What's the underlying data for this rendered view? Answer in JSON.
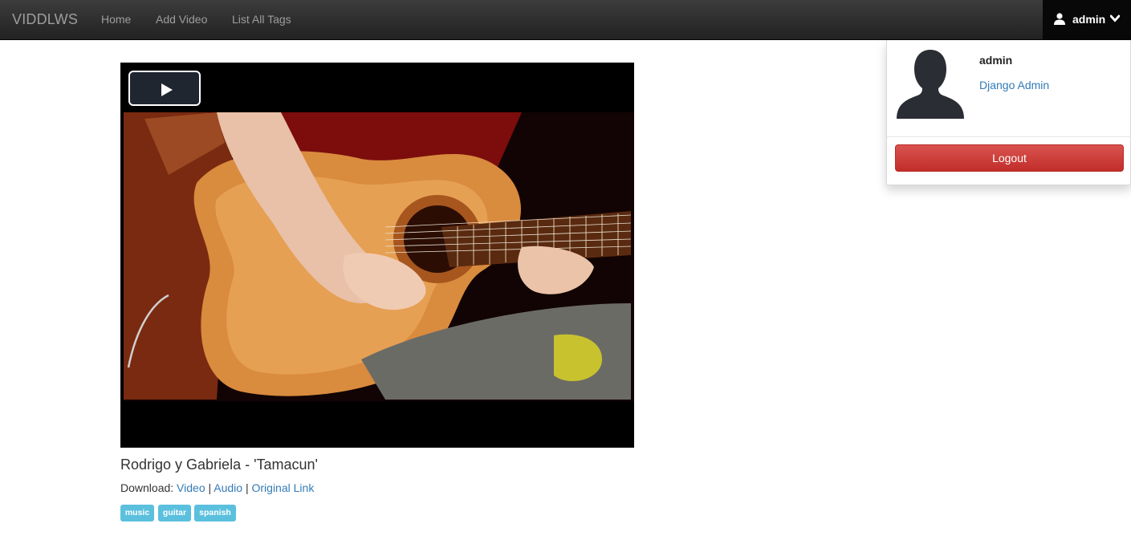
{
  "navbar": {
    "brand": "VIDDLWS",
    "links": [
      "Home",
      "Add Video",
      "List All Tags"
    ],
    "user": "admin"
  },
  "user_menu": {
    "username": "admin",
    "admin_link": "Django Admin",
    "logout_label": "Logout"
  },
  "video": {
    "title": "Rodrigo y Gabriela - 'Tamacun'",
    "download_label": "Download:",
    "download_links": [
      "Video",
      "Audio",
      "Original Link"
    ],
    "separator": "|",
    "tags": [
      "music",
      "guitar",
      "spanish"
    ]
  },
  "icons": {
    "user": "user-icon",
    "chevron": "chevron-down-icon",
    "avatar": "avatar-silhouette-icon",
    "play": "play-icon"
  },
  "colors": {
    "navbar": "#222222",
    "link": "#337ab7",
    "danger": "#d9534f",
    "tag": "#5bc0de"
  }
}
